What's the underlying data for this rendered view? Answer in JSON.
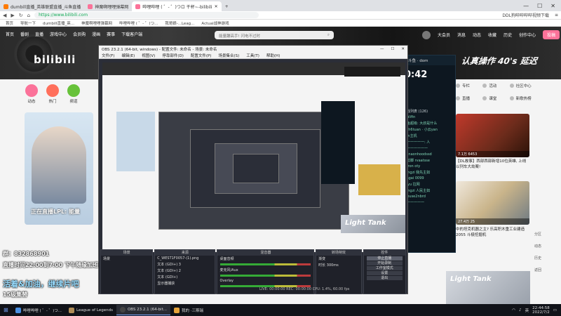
{
  "browser": {
    "tabs": [
      {
        "label": "dumbill直播_英雄联盟直播_斗鱼直播",
        "active": false
      },
      {
        "label": "神魔啊哩哩弹幕网",
        "active": false
      },
      {
        "label": "哔哩哔哩 ( ゜- ゜)つロ 干杯~-bilibili",
        "active": true
      }
    ],
    "new_tab": "+",
    "window_controls": [
      "—",
      "☐",
      "✕"
    ],
    "url": "https://www.bilibili.com",
    "addr_right": "DDL狗哔哔哔哔视频下载",
    "bookmarks": [
      "首页",
      "导航一下",
      "dumbill直播_英...",
      "神魔啊哩哩弹幕网",
      "哔哩哔哩 ( ゜- ゜)つ...",
      "我哥娘-...Leag...",
      "Actual战神游戏"
    ]
  },
  "bili": {
    "nav": [
      "首页",
      "番剧",
      "直播",
      "游戏中心",
      "会员购",
      "漫画",
      "赛事",
      "下载客户端"
    ],
    "logo": "bilibili",
    "search_placeholder": "能量蹦高手! 闪电不过时",
    "header_right": [
      "大会员",
      "消息",
      "动态",
      "收藏",
      "历史",
      "创作中心"
    ],
    "upload": "投稿",
    "event_title": "认真操作 40's 延迟",
    "categories": [
      {
        "label": "动态",
        "color": "#fb7299"
      },
      {
        "label": "热门",
        "color": "#ff6f5b"
      },
      {
        "label": "频道",
        "color": "#67c23a"
      }
    ],
    "promo_caption": "正在直播LPL: 能量",
    "right_nav": [
      "专栏",
      "活动",
      "社区中心",
      "直播",
      "课堂",
      "新歌热榜"
    ],
    "cards": [
      {
        "meta": "7.1万  6453",
        "title": "英雄联盟世界冠军! 能量"
      },
      {
        "meta": "37.1万  4453",
        "title": "【DL故事】西部西部新增10位英雄, 上线以列车大劫案!"
      },
      {
        "meta": "27.4万  25",
        "title": "中的坦克机器之主? 乐高积木重工业建造2055 斗极挖掘机"
      }
    ],
    "float_side": [
      "分区",
      "动态",
      "历史",
      "返回"
    ]
  },
  "chat": {
    "header": "斗鱼 · dom",
    "timer": "0:42",
    "lines": [
      {
        "text": "游戏列表 (126)",
        "color": "w"
      },
      {
        "text": "prolifin",
        "color": "g"
      },
      {
        "text": "斗鱼超级: 大叔是什么",
        "color": "g"
      },
      {
        "text": "iceh6tuan · 小云yan",
        "color": "g"
      },
      {
        "text": "iron主机",
        "color": "g"
      },
      {
        "text": "一一一一一一: 人",
        "color": "g"
      },
      {
        "text": "一一一一一一一",
        "color": "g"
      },
      {
        "text": "xianaonhoodssd",
        "color": "g"
      },
      {
        "text": "大剪脚 rvaatsse",
        "color": "g"
      },
      {
        "text": "ultron oty",
        "color": "g"
      },
      {
        "text": "gangzi 我先主如",
        "color": "g"
      },
      {
        "text": "aingai 0099",
        "color": "g"
      },
      {
        "text": "xoyu 拉网",
        "color": "g"
      },
      {
        "text": "gangzi 人民主如",
        "color": "g"
      },
      {
        "text": "scouse2nbrd",
        "color": "g"
      },
      {
        "text": "一一一一一一",
        "color": "g"
      }
    ]
  },
  "obs": {
    "title": "OBS 23.2.1 (64-bit, windows) - 配置文件: 未命名 - 场景: 未命名",
    "menu": [
      "文件(F)",
      "编辑(E)",
      "视图(V)",
      "停靠部件(D)",
      "配置文件(P)",
      "场景集合(S)",
      "工具(T)",
      "帮助(H)"
    ],
    "docks": {
      "scenes": {
        "title": "场景",
        "items": [
          "场景"
        ]
      },
      "sources": {
        "title": "来源",
        "items": [
          "C_WEST1F0057-(1).png",
          "文本 (GDI+) 3",
          "文本 (GDI+) 2",
          "文本 (GDI+)",
          "显示器捕获"
        ]
      },
      "mixer": {
        "title": "混音器",
        "items": [
          "桌面音频",
          "麦克风/Aux",
          "Overlay"
        ]
      },
      "transitions": {
        "title": "转场特效",
        "items": [
          "渐变",
          "时长 300ms"
        ]
      },
      "controls": {
        "title": "控件",
        "items": [
          "停止直播",
          "开始录制",
          "工作室模式",
          "设置",
          "退出"
        ]
      }
    },
    "status": "LIVE: 00:00:00  REC: 00:00:00  CPU: 1.4%, 60.00 fps"
  },
  "overlay": {
    "group": "群：832868901",
    "schedule": "直播时间22:00到7:00  下午随缘加班",
    "tagline": "活着&加油，继续片吧",
    "prefix": "15级集替",
    "tank": "Light Tank"
  },
  "taskbar": {
    "items": [
      {
        "label": "哔哩哔哩 ( ゜- ゜)つ...",
        "color": "#4a90e2"
      },
      {
        "label": "League of Legends",
        "color": "#b08d57"
      },
      {
        "label": "OBS 23.2.1 (64-bit...",
        "color": "#444"
      },
      {
        "label": "我的 ·三斯瑞",
        "color": "#e5a33a"
      }
    ],
    "tray_lang": "英",
    "time": "22:44:58",
    "date": "2022/7/2"
  }
}
